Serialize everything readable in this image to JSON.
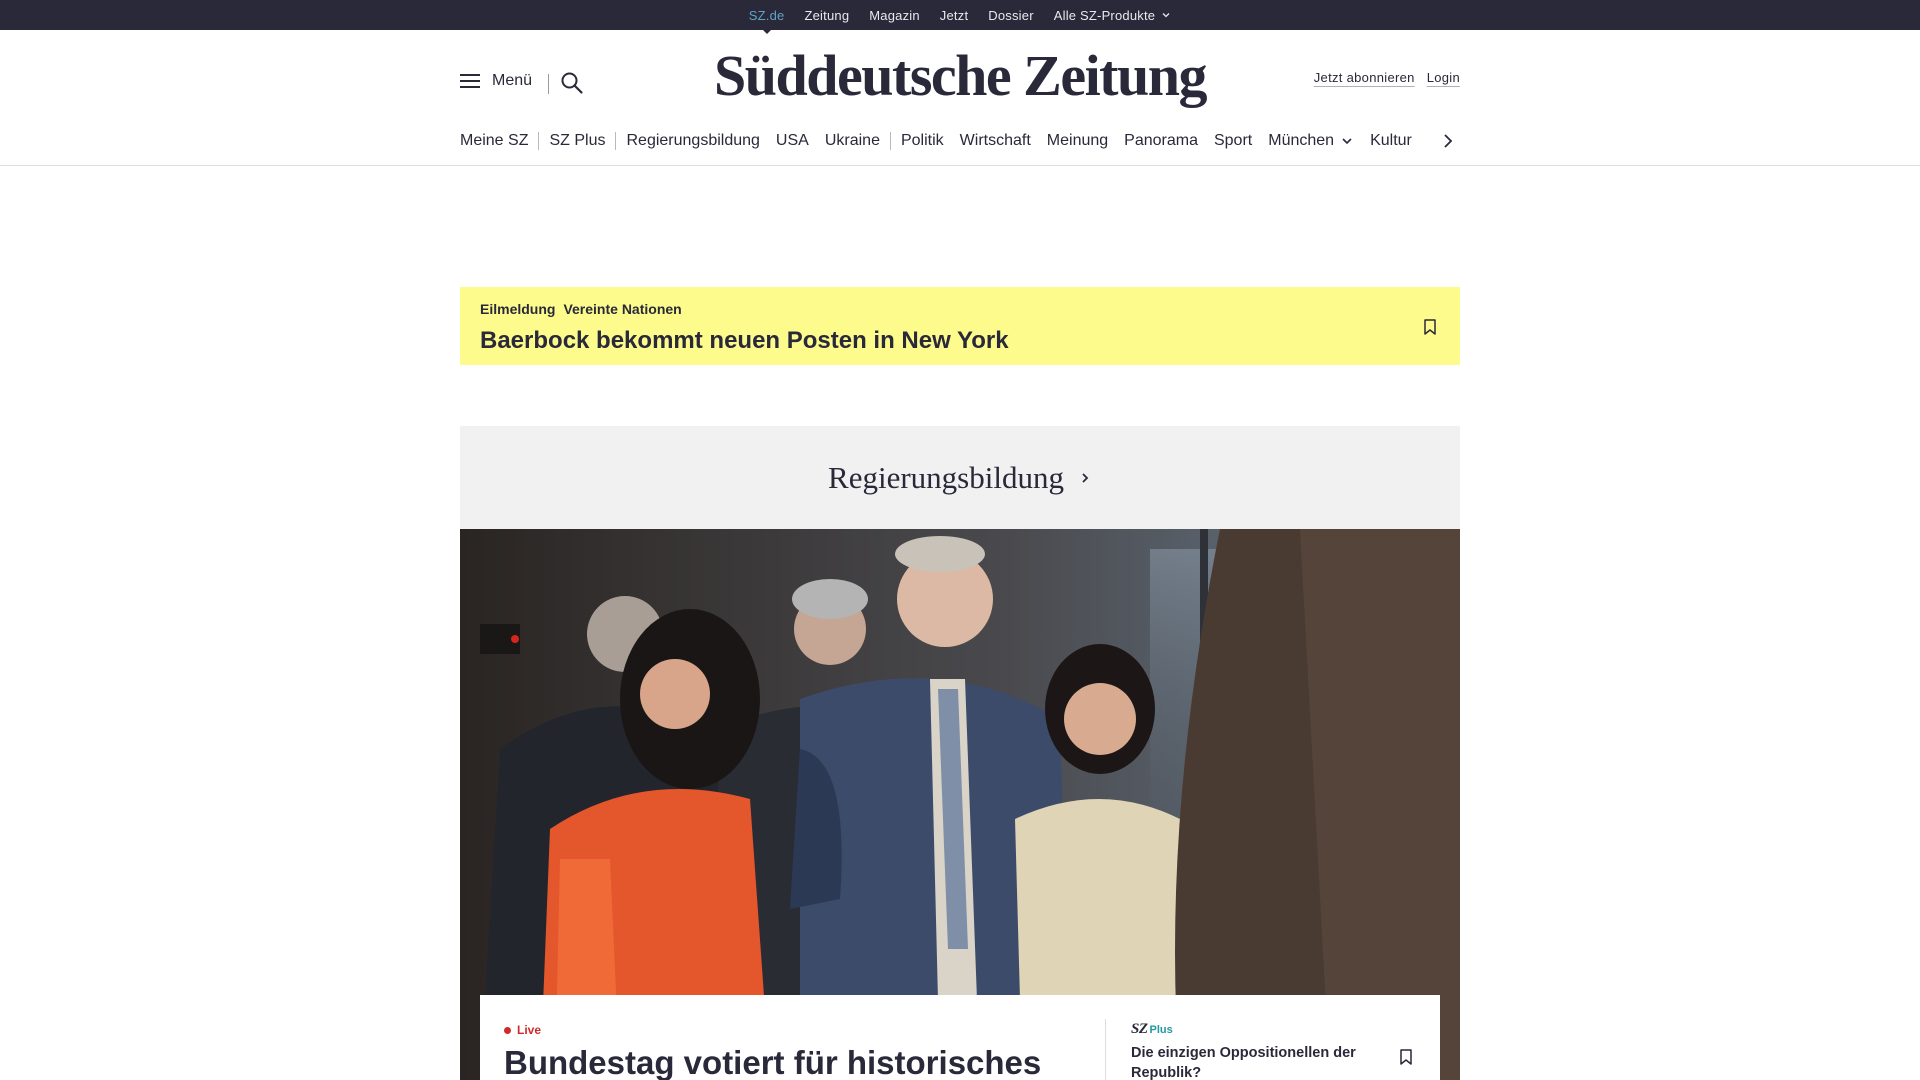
{
  "topbar": {
    "links": [
      "SZ.de",
      "Zeitung",
      "Magazin",
      "Jetzt",
      "Dossier",
      "Alle SZ-Produkte"
    ],
    "active": "SZ.de",
    "colors": {
      "background": "#29293a",
      "active": "#5fa3c8"
    }
  },
  "masthead": {
    "menu_label": "Menü",
    "logo_text": "Süddeutsche Zeitung",
    "subscribe_label": "Jetzt abonnieren",
    "login_label": "Login",
    "icons": {
      "menu": "hamburger-icon",
      "search": "search-icon"
    }
  },
  "nav": {
    "items": [
      "Meine SZ",
      "SZ Plus",
      "Regierungsbildung",
      "USA",
      "Ukraine",
      "Politik",
      "Wirtschaft",
      "Meinung",
      "Panorama",
      "Sport",
      "München",
      "Kultur"
    ],
    "next_icon": "chevron-right-icon"
  },
  "breaking": {
    "label": "Eilmeldung",
    "topic": "Vereinte Nationen",
    "title": "Baerbock bekommt neuen Posten in New York",
    "background": "#fdfb8b"
  },
  "section": {
    "title": "Regierungsbildung"
  },
  "teaser": {
    "live_label": "Live",
    "title": "Bundestag votiert für historisches",
    "side_brand": "SZ",
    "side_brand_suffix": "Plus",
    "side_title": "Die einzigen Oppositionellen der Republik?",
    "live_color": "#cf2b2b",
    "plus_color": "#1e9aa0"
  }
}
